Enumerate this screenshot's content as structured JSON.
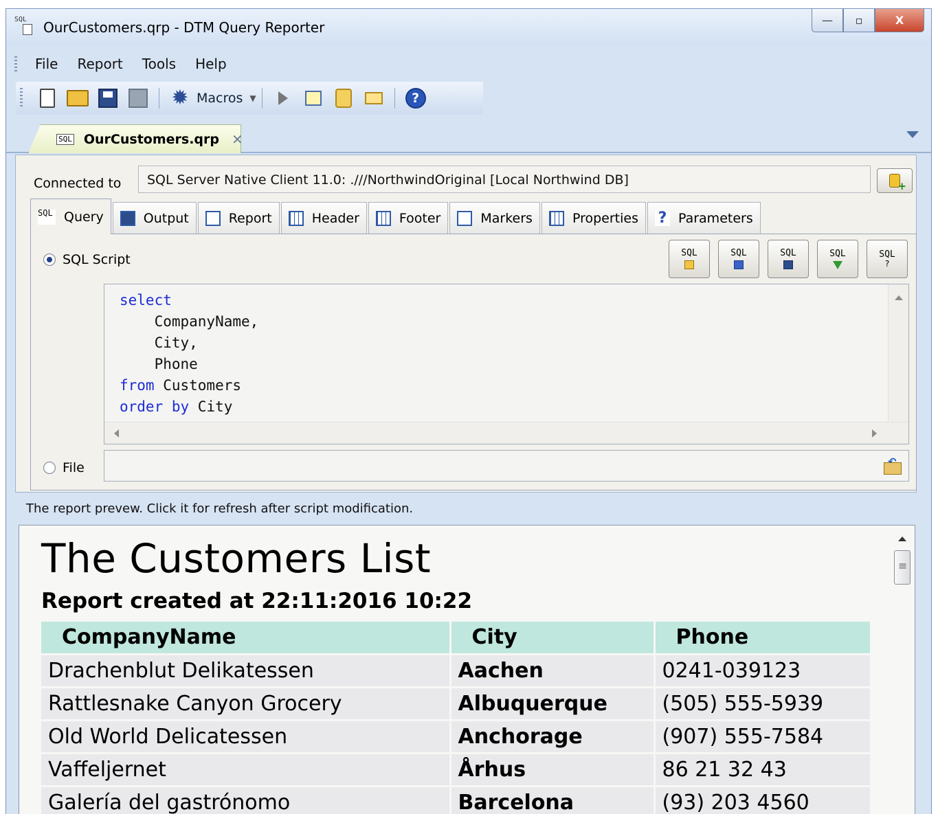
{
  "window": {
    "title": "OurCustomers.qrp - DTM Query Reporter",
    "minimize_glyph": "—",
    "maximize_glyph": "▫",
    "close_glyph": "X"
  },
  "menu": {
    "items": [
      "File",
      "Report",
      "Tools",
      "Help"
    ]
  },
  "toolbar": {
    "macros_label": "Macros",
    "help_glyph": "?",
    "icons": [
      "new-icon",
      "open-icon",
      "save-icon",
      "save-all-icon",
      "gear-icon",
      "play-icon",
      "report-icon",
      "script-icon",
      "mail-icon",
      "help-icon"
    ]
  },
  "document_tab": {
    "label": "OurCustomers.qrp",
    "close_glyph": "✕",
    "icon_text": "SQL"
  },
  "connection": {
    "label": "Connected to",
    "value": "SQL Server Native Client 11.0: .///NorthwindOriginal [Local Northwind DB]"
  },
  "tabs": [
    {
      "label": "Query",
      "icon": "sql-icon",
      "icon_text": "SQL"
    },
    {
      "label": "Output",
      "icon": "save-icon"
    },
    {
      "label": "Report",
      "icon": "report-icon"
    },
    {
      "label": "Header",
      "icon": "grid-icon"
    },
    {
      "label": "Footer",
      "icon": "grid-icon"
    },
    {
      "label": "Markers",
      "icon": "checklist-icon"
    },
    {
      "label": "Properties",
      "icon": "columns-icon"
    },
    {
      "label": "Parameters",
      "icon": "question-icon",
      "icon_text": "?"
    }
  ],
  "query": {
    "sql_script_label": "SQL Script",
    "file_label": "File",
    "file_value": "",
    "sql_buttons": [
      {
        "text": "SQL",
        "name": "sql-open-button"
      },
      {
        "text": "SQL",
        "name": "sql-copy-button"
      },
      {
        "text": "SQL",
        "name": "sql-save-button"
      },
      {
        "text": "SQL",
        "name": "sql-execute-button"
      },
      {
        "text": "SQL",
        "name": "sql-help-button"
      }
    ],
    "sql_help_glyph": "?",
    "code": [
      [
        {
          "t": "select",
          "kw": true
        }
      ],
      [
        {
          "t": "    CompanyName,",
          "kw": false
        }
      ],
      [
        {
          "t": "    City,",
          "kw": false
        }
      ],
      [
        {
          "t": "    Phone",
          "kw": false
        }
      ],
      [
        {
          "t": "from",
          "kw": true
        },
        {
          "t": " Customers",
          "kw": false
        }
      ],
      [
        {
          "t": "order by",
          "kw": true
        },
        {
          "t": " City",
          "kw": false
        }
      ]
    ]
  },
  "preview": {
    "caption": "The report prevew. Click it for refresh after script modification.",
    "title": "The Customers List",
    "subtitle": "Report created at 22:11:2016 10:22",
    "columns": [
      "CompanyName",
      "City",
      "Phone"
    ],
    "rows": [
      [
        "Drachenblut Delikatessen",
        "Aachen",
        "0241-039123"
      ],
      [
        "Rattlesnake Canyon Grocery",
        "Albuquerque",
        "(505) 555-5939"
      ],
      [
        "Old World Delicatessen",
        "Anchorage",
        "(907) 555-7584"
      ],
      [
        "Vaffeljernet",
        "Århus",
        "86 21 32 43"
      ],
      [
        "Galería del gastrónomo",
        "Barcelona",
        "(93) 203 4560"
      ]
    ]
  },
  "colors": {
    "keyword": "#1c2cd8",
    "header_row": "#bfe7dd",
    "row": "#e9e9eb",
    "window_frame": "#d6e3f3"
  }
}
